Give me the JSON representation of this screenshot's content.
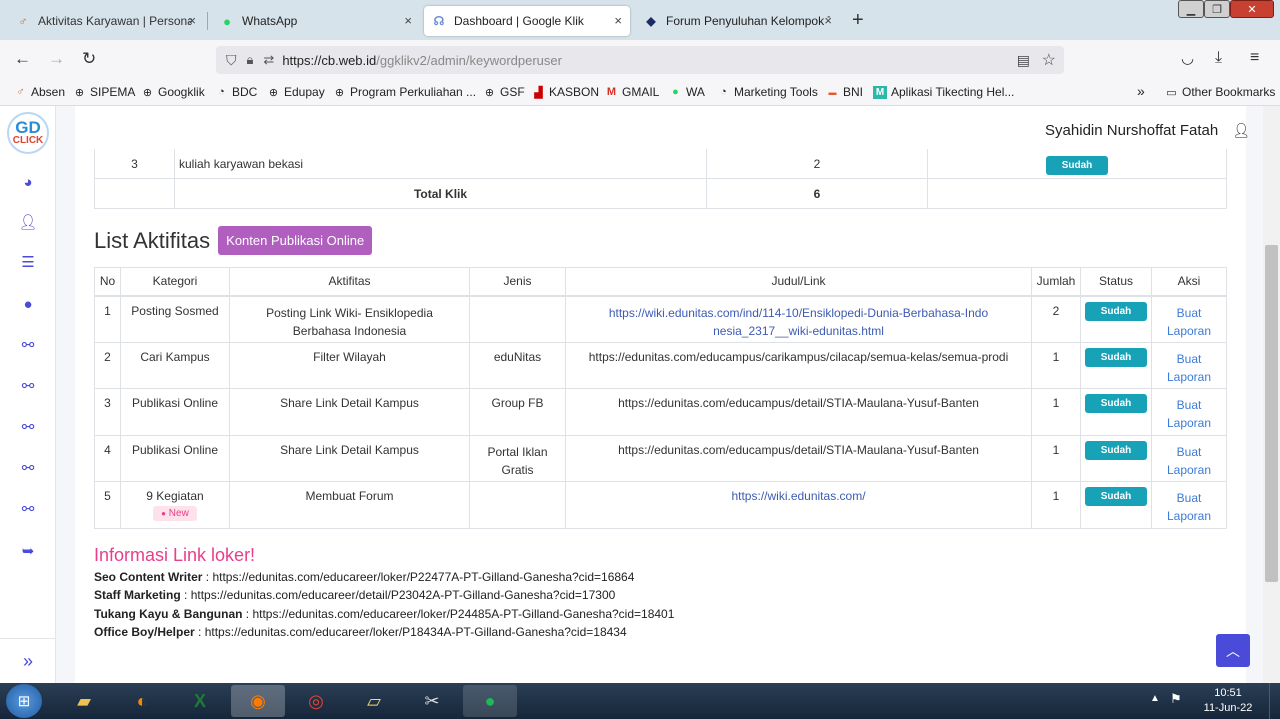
{
  "browser": {
    "tabs": [
      {
        "label": "Aktivitas Karyawan | Personalia",
        "close": "×"
      },
      {
        "label": "WhatsApp",
        "close": "×"
      },
      {
        "label": "Dashboard | Google Klik",
        "close": "×"
      },
      {
        "label": "Forum Penyuluhan Kelompok T",
        "close": "×"
      }
    ],
    "new_tab": "+",
    "url_host": "https://cb.web.id",
    "url_path": "/ggklikv2/admin/keywordperuser",
    "bookmarks": [
      "Absen",
      "SIPEMA",
      "Googklik",
      "BDC",
      "Edupay",
      "Program Perkuliahan ...",
      "GSF",
      "KASBON",
      "GMAIL",
      "WA",
      "Marketing Tools",
      "BNI",
      "Aplikasi Tikecting Hel..."
    ],
    "other_bookmarks": "Other Bookmarks"
  },
  "app": {
    "logo_top": "GD",
    "logo_bottom": "CLICK",
    "user_name": "Syahidin Nurshoffat Fatah"
  },
  "summary_table": {
    "row": {
      "no": "3",
      "keyword": "kuliah karyawan bekasi",
      "klik": "2",
      "status": "Sudah"
    },
    "total_label": "Total Klik",
    "total_value": "6"
  },
  "aktifitas": {
    "title": "List Aktifitas",
    "button": "Konten Publikasi Online",
    "headers": [
      "No",
      "Kategori",
      "Aktifitas",
      "Jenis",
      "Judul/Link",
      "Jumlah",
      "Status",
      "Aksi"
    ],
    "rows": [
      {
        "no": "1",
        "kategori": "Posting Sosmed",
        "aktifitas": "Posting Link Wiki- Ensiklopedia Berbahasa Indonesia",
        "jenis": "",
        "link": "https://wiki.edunitas.com/ind/114-10/Ensiklopedi-Dunia-Berbahasa-Indonesia_2317__wiki-edunitas.html",
        "jumlah": "2",
        "status": "Sudah",
        "aksi": "Buat Laporan"
      },
      {
        "no": "2",
        "kategori": "Cari Kampus",
        "aktifitas": "Filter Wilayah",
        "jenis": "eduNitas",
        "link": "https://edunitas.com/educampus/carikampus/cilacap/semua-kelas/semua-prodi",
        "jumlah": "1",
        "status": "Sudah",
        "aksi": "Buat Laporan"
      },
      {
        "no": "3",
        "kategori": "Publikasi Online",
        "aktifitas": "Share Link Detail Kampus",
        "jenis": "Group FB",
        "link": "https://edunitas.com/educampus/detail/STIA-Maulana-Yusuf-Banten",
        "jumlah": "1",
        "status": "Sudah",
        "aksi": "Buat Laporan"
      },
      {
        "no": "4",
        "kategori": "Publikasi Online",
        "aktifitas": "Share Link Detail Kampus",
        "jenis": "Portal Iklan Gratis",
        "link": "https://edunitas.com/educampus/detail/STIA-Maulana-Yusuf-Banten",
        "jumlah": "1",
        "status": "Sudah",
        "aksi": "Buat Laporan"
      },
      {
        "no": "5",
        "kategori": "9 Kegiatan",
        "badge": "New",
        "aktifitas": "Membuat Forum",
        "jenis": "",
        "link": "https://wiki.edunitas.com/",
        "jumlah": "1",
        "status": "Sudah",
        "aksi": "Buat Laporan"
      }
    ]
  },
  "loker": {
    "title": "Informasi Link loker!",
    "items": [
      {
        "label": "Seo Content Writer",
        "url": "https://edunitas.com/educareer/loker/P22477A-PT-Gilland-Ganesha?cid=16864"
      },
      {
        "label": "Staff Marketing",
        "url": "https://edunitas.com/educareer/detail/P23042A-PT-Gilland-Ganesha?cid=17300"
      },
      {
        "label": "Tukang Kayu & Bangunan",
        "url": "https://edunitas.com/educareer/loker/P24485A-PT-Gilland-Ganesha?cid=18401"
      },
      {
        "label": "Office Boy/Helper",
        "url": "https://edunitas.com/educareer/loker/P18434A-PT-Gilland-Ganesha?cid=18434"
      }
    ],
    "separator": " : "
  },
  "taskbar": {
    "time": "10:51",
    "date": "11-Jun-22"
  },
  "colors": {
    "accent_purple": "#b05fbf",
    "badge_teal": "#17a2b8",
    "loker_title": "#e83e8c",
    "sidebar_icon": "#4a4bd8"
  }
}
